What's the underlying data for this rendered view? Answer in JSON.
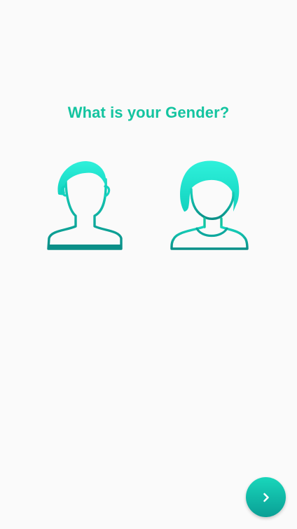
{
  "screen": {
    "question": "What is your Gender?"
  },
  "options": [
    {
      "id": "male",
      "icon": "male-avatar-icon"
    },
    {
      "id": "female",
      "icon": "female-avatar-icon"
    }
  ],
  "next_button": {
    "icon": "chevron-right-icon"
  },
  "colors": {
    "accent": "#14c4a0",
    "icon_top": "#27efd6",
    "icon_bottom": "#0a8f88",
    "background": "#fafafa"
  }
}
